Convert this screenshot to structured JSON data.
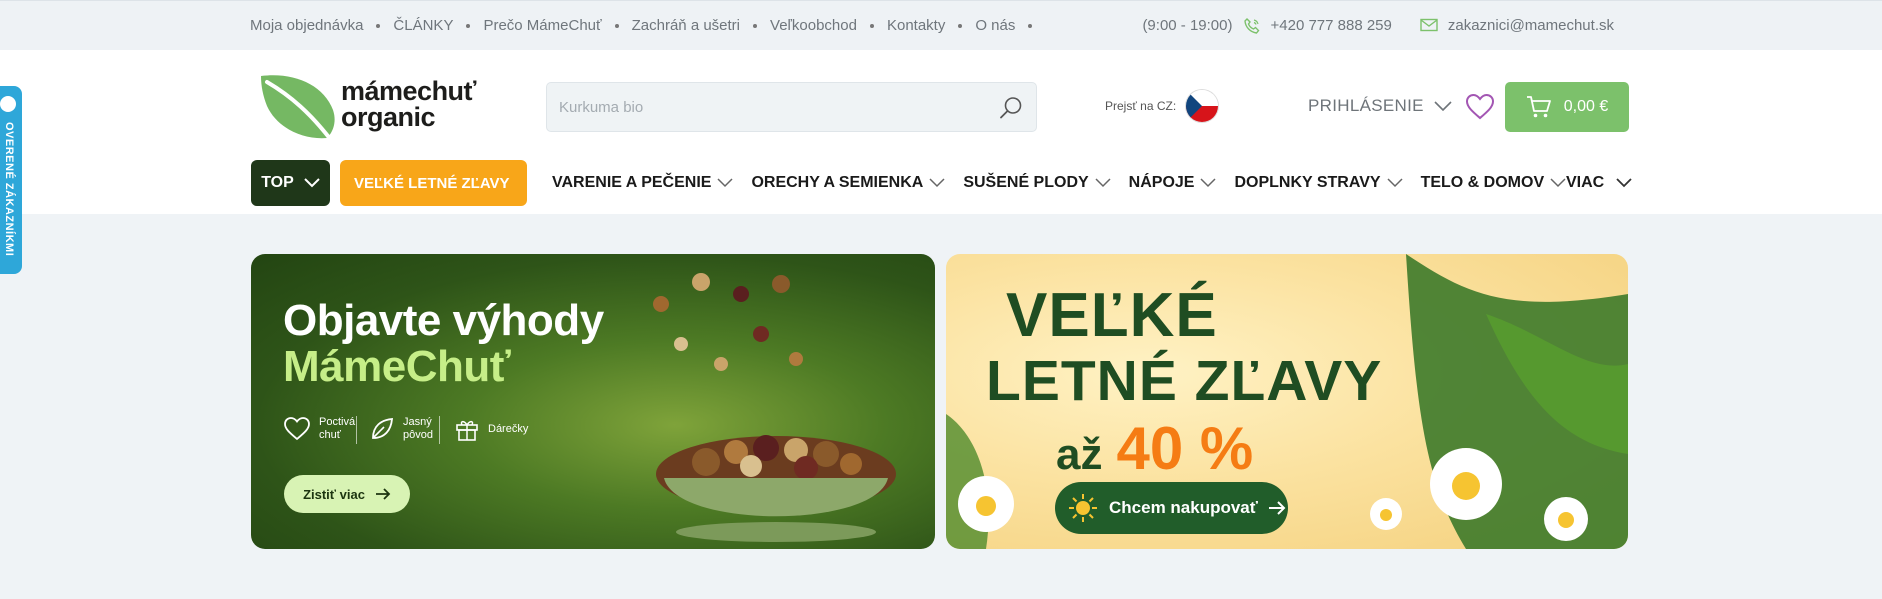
{
  "topbar": {
    "links": [
      "Moja objednávka",
      "ČLÁNKY",
      "Prečo MámeChuť",
      "Zachráň a ušetri",
      "Veľkoobchod",
      "Kontakty",
      "O nás"
    ],
    "hours": "(9:00 - 19:00)",
    "phone": "+420 777 888 259",
    "email": "zakaznici@mamechut.sk"
  },
  "header": {
    "logo_line1": "mámechuť",
    "logo_line2": "organic",
    "search_placeholder": "Kurkuma bio",
    "country_label": "Prejsť na CZ:",
    "login_label": "PRIHLÁSENIE",
    "cart_total": "0,00 €"
  },
  "nav": {
    "top_label": "TOP",
    "sale_label": "VEĽKÉ LETNÉ ZĽAVY",
    "items": [
      "VARENIE A PEČENIE",
      "ORECHY A SEMIENKA",
      "SUŠENÉ PLODY",
      "NÁPOJE",
      "DOPLNKY STRAVY",
      "TELO & DOMOV"
    ],
    "more_label": "VIAC"
  },
  "side_tab": {
    "label": "OVERENÉ ZÁKAZNÍKMI"
  },
  "banner_left": {
    "title_line1": "Objavte výhody",
    "title_line2": "MámeChuť",
    "features": [
      {
        "icon": "heart-outline-icon",
        "line1": "Poctivá",
        "line2": "chuť"
      },
      {
        "icon": "leaf-outline-icon",
        "line1": "Jasný",
        "line2": "pôvod"
      },
      {
        "icon": "gift-outline-icon",
        "line1": "Dárečky",
        "line2": ""
      }
    ],
    "cta_label": "Zistiť viac"
  },
  "banner_right": {
    "line1": "VEĽKÉ",
    "line2": "LETNÉ ZĽAVY",
    "prefix": "až",
    "percent": "40 %",
    "cta_label": "Chcem nakupovať"
  },
  "colors": {
    "brand_green": "#7cc16b",
    "dark_green": "#1f3719",
    "sale_orange": "#f8a619",
    "wishlist_purple": "#a356b3",
    "side_tab_blue": "#2ea7d9"
  }
}
